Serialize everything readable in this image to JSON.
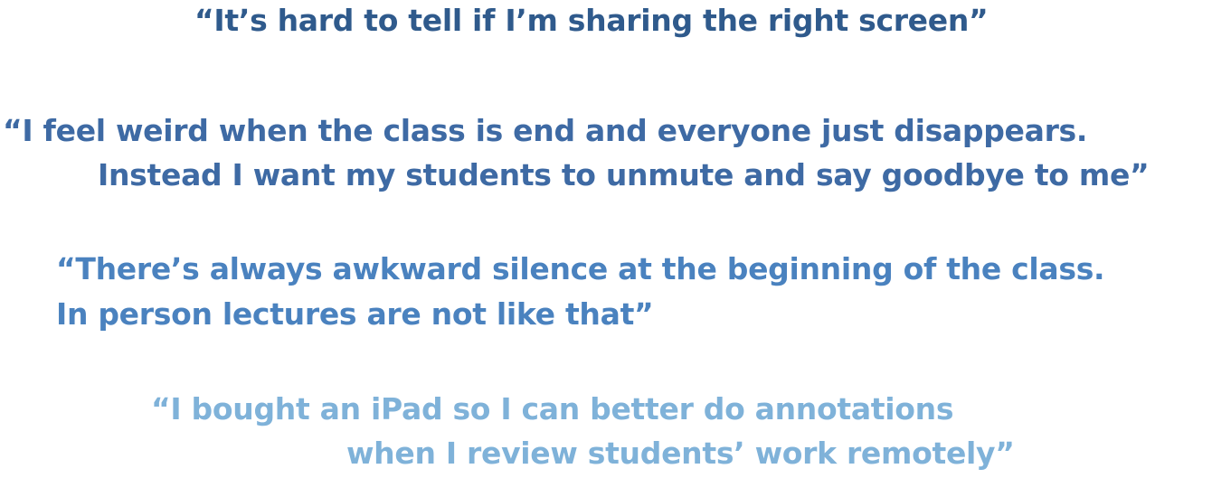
{
  "quotes": [
    {
      "lines": [
        "“It’s hard to tell if I’m sharing the right screen”"
      ],
      "color": "#2f5a8c"
    },
    {
      "lines": [
        "“I feel weird when the class is end and everyone just disappears.",
        "Instead I want my students to unmute and say goodbye to me”"
      ],
      "color": "#3e6aa4"
    },
    {
      "lines": [
        "“There’s always awkward silence at the beginning of the class.",
        "In person lectures are not like that”"
      ],
      "color": "#4a82bf"
    },
    {
      "lines": [
        "“I bought an iPad so I can better do annotations",
        "when I review students’ work remotely”"
      ],
      "color": "#7fb2d9"
    }
  ]
}
